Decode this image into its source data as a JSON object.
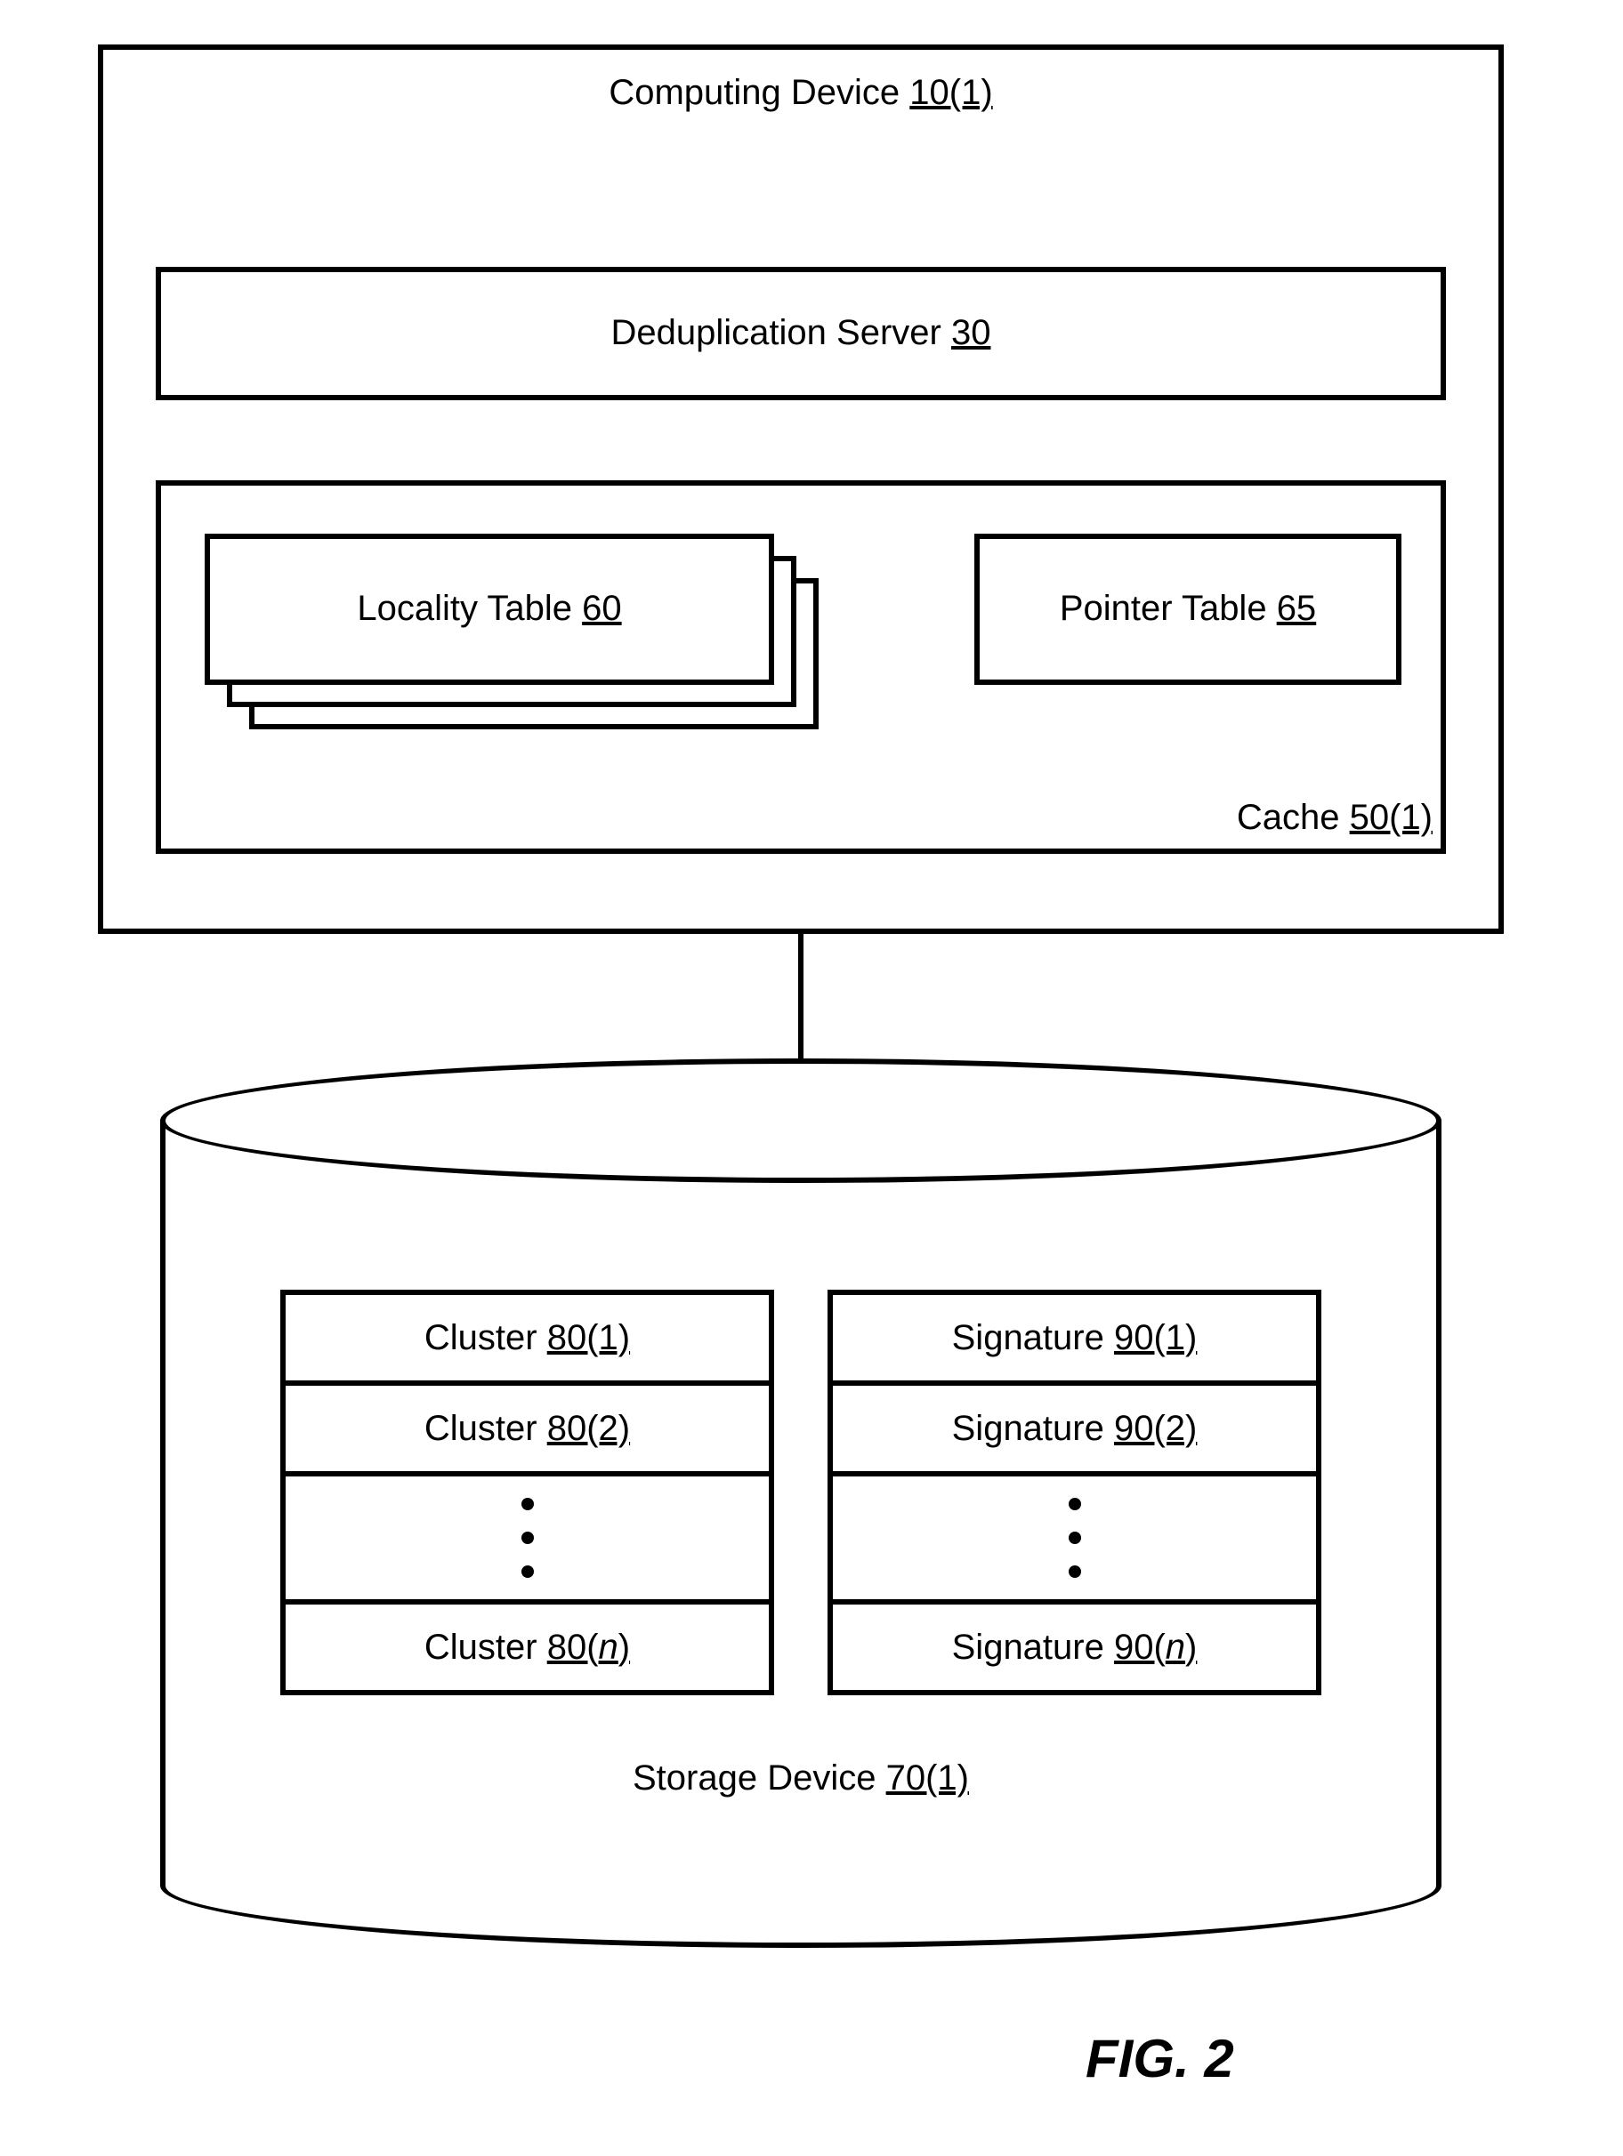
{
  "computing_device": {
    "label_prefix": "Computing Device ",
    "ref": "10(1)",
    "dedup": {
      "label_prefix": "Deduplication Server ",
      "ref": "30"
    },
    "cache": {
      "label_prefix": "Cache ",
      "ref": "50(1)",
      "locality": {
        "label_prefix": "Locality Table ",
        "ref": "60"
      },
      "pointer": {
        "label_prefix": "Pointer Table ",
        "ref": "65"
      }
    }
  },
  "storage_device": {
    "label_prefix": "Storage Device ",
    "ref": "70(1)",
    "clusters": [
      {
        "label_prefix": "Cluster ",
        "ref": "80(1)",
        "italic_n": false
      },
      {
        "label_prefix": "Cluster ",
        "ref": "80(2)",
        "italic_n": false
      },
      {
        "label_prefix": "Cluster ",
        "ref_a": "80(",
        "ref_n": "n",
        "ref_b": ")",
        "italic_n": true
      }
    ],
    "signatures": [
      {
        "label_prefix": "Signature ",
        "ref": "90(1)",
        "italic_n": false
      },
      {
        "label_prefix": "Signature ",
        "ref": "90(2)",
        "italic_n": false
      },
      {
        "label_prefix": "Signature ",
        "ref_a": "90(",
        "ref_n": "n",
        "ref_b": ")",
        "italic_n": true
      }
    ]
  },
  "figure_caption": "FIG. 2"
}
